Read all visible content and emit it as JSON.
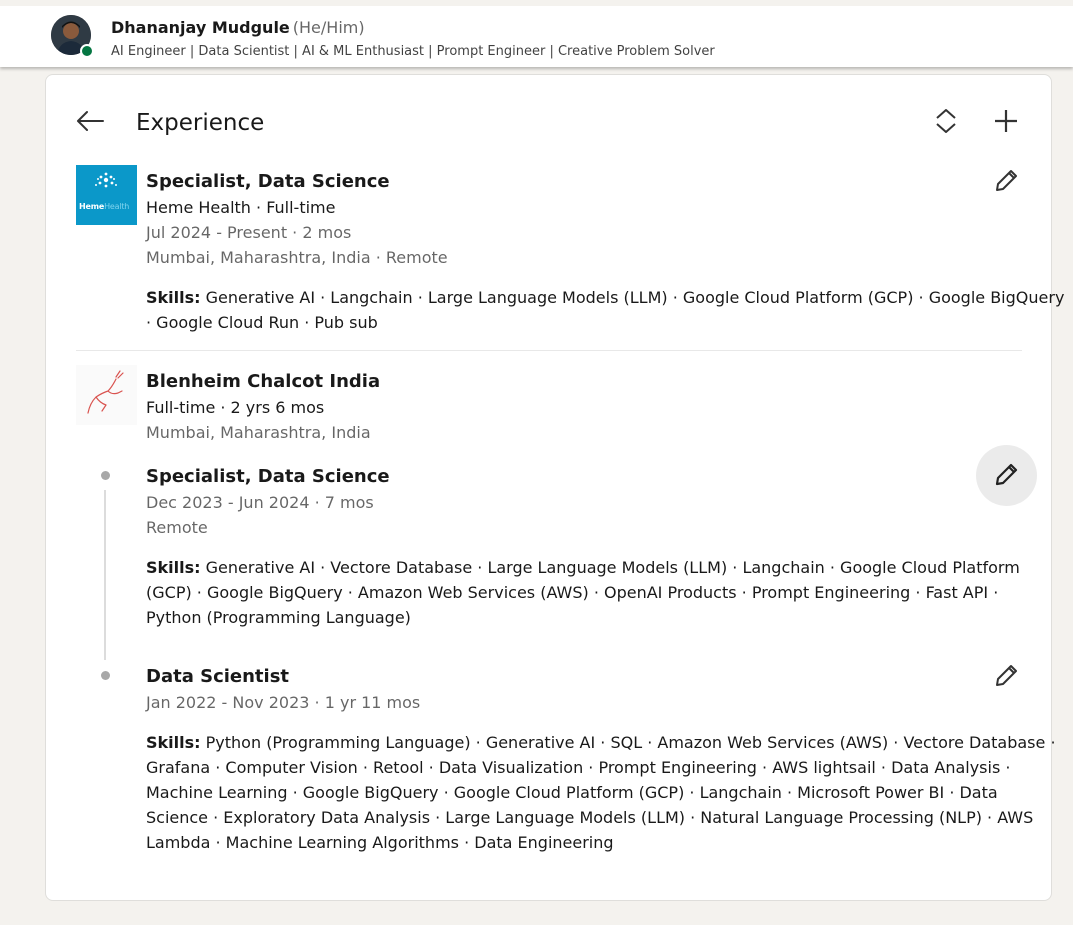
{
  "profile": {
    "name": "Dhananjay Mudgule",
    "pronouns": "(He/Him)",
    "headline": "AI Engineer | Data Scientist | AI & ML Enthusiast | Prompt Engineer | Creative Problem Solver",
    "status": "online"
  },
  "section": {
    "title": "Experience",
    "icons": {
      "back": "arrow-left-icon",
      "reorder": "reorder-icon",
      "add": "plus-icon",
      "edit": "pencil-icon"
    }
  },
  "experiences": [
    {
      "company_logo": "heme-health-logo",
      "logo_text": "HemeHealth",
      "title": "Specialist, Data Science",
      "company_line": "Heme Health · Full-time",
      "dates": "Jul 2024 - Present · 2 mos",
      "location": "Mumbai, Maharashtra, India · Remote",
      "skills_label": "Skills:",
      "skills_line1": "Generative AI · Langchain · Large Language Models (LLM) · Google Cloud Platform (GCP) · Google BigQuery",
      "skills_line2": "· Google Cloud Run · Pub sub"
    }
  ],
  "company_group": {
    "company_logo": "blenheim-chalcot-logo",
    "name": "Blenheim Chalcot India",
    "employment": "Full-time · 2 yrs 6 mos",
    "location": "Mumbai, Maharashtra, India",
    "roles": [
      {
        "title": "Specialist, Data Science",
        "dates": "Dec 2023 - Jun 2024 · 7 mos",
        "location": "Remote",
        "skills_label": "Skills:",
        "skills_lines": [
          "Generative AI · Vectore Database · Large Language Models (LLM) · Langchain · Google Cloud Platform",
          "(GCP) · Google BigQuery · Amazon Web Services (AWS) · OpenAI Products · Prompt Engineering · Fast API ·",
          "Python (Programming Language)"
        ]
      },
      {
        "title": "Data Scientist",
        "dates": "Jan 2022 - Nov 2023 · 1 yr 11 mos",
        "skills_label": "Skills:",
        "skills_lines": [
          "Python (Programming Language) · Generative AI · SQL · Amazon Web Services (AWS) · Vectore Database ·",
          "Grafana · Computer Vision · Retool · Data Visualization · Prompt Engineering · AWS lightsail · Data Analysis ·",
          "Machine Learning · Google BigQuery · Google Cloud Platform (GCP) · Langchain · Microsoft Power BI · Data",
          "Science · Exploratory Data Analysis · Large Language Models (LLM) · Natural Language Processing (NLP) · AWS",
          "Lambda · Machine Learning Algorithms · Data Engineering"
        ]
      }
    ]
  },
  "colors": {
    "background": "#f4f2ee",
    "online": "#057642",
    "heme_logo_bg": "#0b98c9"
  }
}
